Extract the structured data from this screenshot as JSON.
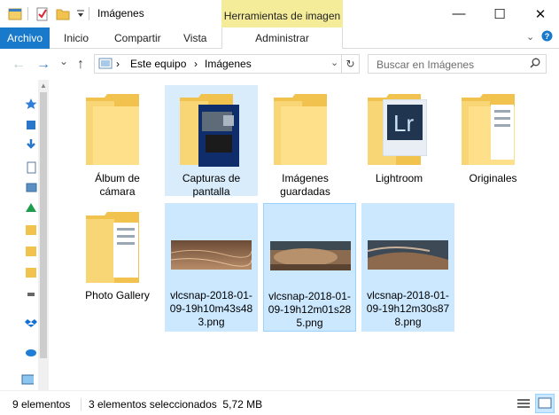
{
  "title": {
    "text": "Imágenes",
    "contextual_tab_title": "Herramientas de imagen",
    "controls": {
      "minimize": "—",
      "maximize": "☐",
      "close": "✕"
    }
  },
  "ribbon": {
    "tabs": [
      {
        "label": "Archivo"
      },
      {
        "label": "Inicio"
      },
      {
        "label": "Compartir"
      },
      {
        "label": "Vista"
      },
      {
        "label": "Administrar"
      }
    ],
    "collapse_glyph": "⌄",
    "help_glyph": "?"
  },
  "address": {
    "crumbs": [
      "Este equipo",
      "Imágenes"
    ],
    "sep": "›",
    "dropdown_glyph": "⌄",
    "refresh_glyph": "↻"
  },
  "search": {
    "placeholder": "Buscar en Imágenes",
    "icon": "search-icon"
  },
  "nav": {
    "back": "←",
    "forward": "→",
    "recent": "⌄",
    "up": "↑"
  },
  "items": [
    {
      "name": "Álbum de cámara",
      "type": "folder"
    },
    {
      "name": "Capturas de pantalla",
      "type": "folder",
      "state": "hover"
    },
    {
      "name": "Imágenes guardadas",
      "type": "folder"
    },
    {
      "name": "Lightroom",
      "type": "folder"
    },
    {
      "name": "Originales",
      "type": "folder"
    },
    {
      "name": "Photo Gallery",
      "type": "folder"
    },
    {
      "name": "vlcsnap-2018-01-09-19h10m43s483.png",
      "type": "image",
      "state": "selected"
    },
    {
      "name": "vlcsnap-2018-01-09-19h12m01s285.png",
      "type": "image",
      "state": "selected-focus"
    },
    {
      "name": "vlcsnap-2018-01-09-19h12m30s878.png",
      "type": "image",
      "state": "selected"
    }
  ],
  "labels": [
    "Álbum de\ncámara",
    "Capturas de\npantalla",
    "Imágenes\nguardadas",
    "Lightroom",
    "Originales",
    "Photo Gallery",
    "vlcsnap-2018-01-\n09-19h10m43s48\n3.png",
    "vlcsnap-2018-01-\n09-19h12m01s28\n5.png",
    "vlcsnap-2018-01-\n09-19h12m30s87\n8.png"
  ],
  "status": {
    "count": "9 elementos",
    "selection": "3 elementos seleccionados  5,72 MB"
  },
  "colors": {
    "accent": "#1979ca",
    "contextual": "#f5ec9a",
    "selection": "#cce8ff",
    "folder": "#f2c24f"
  }
}
